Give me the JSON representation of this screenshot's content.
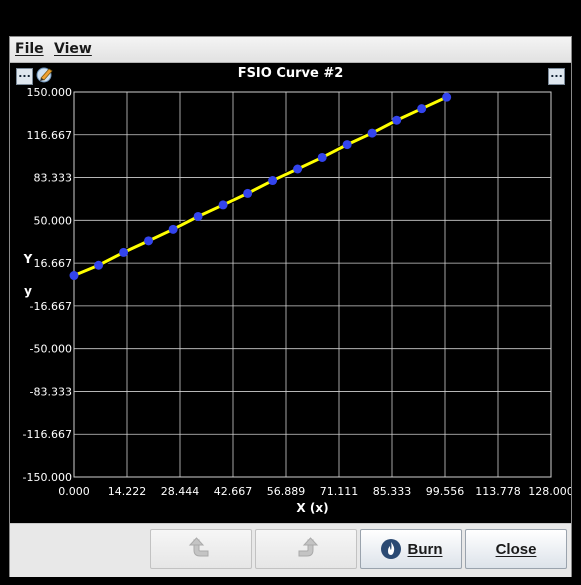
{
  "menu": {
    "file": "File",
    "view": "View"
  },
  "chart_header": {
    "title": "FSIO Curve #2",
    "left_button": "...",
    "right_button": "..."
  },
  "buttons": {
    "burn": "Burn",
    "close": "Close"
  },
  "colors": {
    "line": "#ffff00",
    "points": "#3344ee",
    "grid": "#d0d0d0",
    "background": "#000000"
  },
  "chart_data": {
    "type": "line",
    "title": "FSIO Curve #2",
    "xlabel": "X (x)",
    "ylabel_lines": [
      "Y",
      "y"
    ],
    "xlim": [
      0,
      128
    ],
    "ylim": [
      -150,
      150
    ],
    "x_ticks": [
      "0.000",
      "14.222",
      "28.444",
      "42.667",
      "56.889",
      "71.111",
      "85.333",
      "99.556",
      "113.778",
      "128.000"
    ],
    "y_ticks": [
      "150.000",
      "116.667",
      "83.333",
      "50.000",
      "16.667",
      "-16.667",
      "-50.000",
      "-83.333",
      "-116.667",
      "-150.000"
    ],
    "grid": true,
    "series": [
      {
        "x": [
          0,
          6.6,
          13.3,
          20,
          26.6,
          33.3,
          40,
          46.6,
          53.3,
          60,
          66.6,
          73.3,
          80,
          86.6,
          93.3,
          100
        ],
        "y": [
          7,
          15,
          25,
          34,
          43,
          53,
          62,
          71,
          81,
          90,
          99,
          109,
          118,
          128,
          137,
          146
        ]
      }
    ]
  }
}
